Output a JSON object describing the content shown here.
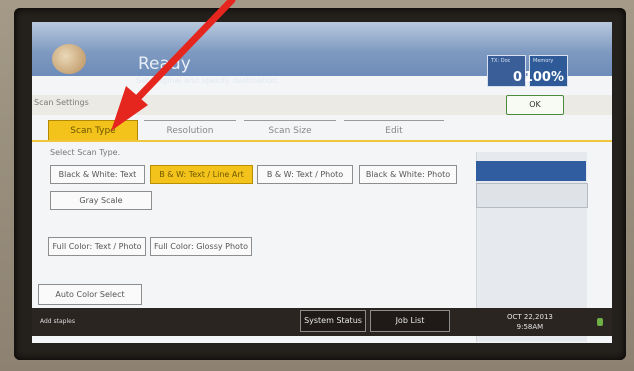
{
  "header": {
    "status_title": "Ready",
    "status_prompt": "Set original and specify destination.",
    "fax_label": "TX: Doc",
    "fax_value": "0",
    "memory_label": "Memory",
    "memory_value": "100%"
  },
  "toolbar": {
    "breadcrumb": "Scan Settings",
    "ok_label": "OK"
  },
  "tabs": [
    {
      "label": "Scan Type",
      "active": true
    },
    {
      "label": "Resolution",
      "active": false
    },
    {
      "label": "Scan Size",
      "active": false
    },
    {
      "label": "Edit",
      "active": false
    }
  ],
  "scan_type": {
    "section_label": "Select Scan Type.",
    "options": [
      {
        "label": "Black & White: Text"
      },
      {
        "label": "B & W: Text / Line Art",
        "selected": true
      },
      {
        "label": "B & W: Text / Photo"
      },
      {
        "label": "Black & White: Photo"
      },
      {
        "label": "Gray Scale"
      },
      {
        "label": "Full Color: Text / Photo"
      },
      {
        "label": "Full Color: Glossy Photo"
      },
      {
        "label": "Auto Color Select"
      }
    ]
  },
  "statusbar": {
    "add_staples": "Add staples",
    "system_status": "System Status",
    "job_list": "Job List",
    "date": "OCT  22,2013",
    "time": "9:58AM"
  },
  "colors": {
    "accent": "#f3c31b",
    "header_blue": "#6d8cb9",
    "ok_border": "#4a8a3c",
    "arrow": "#e5261e"
  }
}
